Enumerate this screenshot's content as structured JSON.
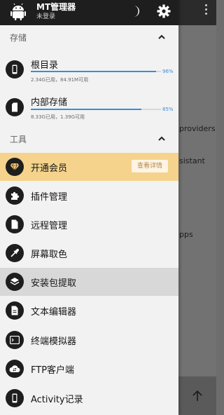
{
  "background": {
    "fragments": [
      "providers",
      "sistant",
      "pps"
    ],
    "up_arrow_icon": "arrow-up-icon"
  },
  "header": {
    "title": "MT管理器",
    "subtitle": "未登录",
    "theme_icon": "moon-icon",
    "settings_icon": "gear-icon"
  },
  "storage": {
    "section_title": "存储",
    "items": [
      {
        "label": "根目录",
        "detail": "2.34G已用，84.91M可用",
        "percent": 96,
        "percent_label": "96%",
        "icon": "phone-icon"
      },
      {
        "label": "内部存储",
        "detail": "8.33G已用，1.39G可用",
        "percent": 85,
        "percent_label": "85%",
        "icon": "sdcard-icon"
      }
    ]
  },
  "tools": {
    "section_title": "工具",
    "items": [
      {
        "label": "开通会员",
        "icon": "diamond-icon",
        "badge": "查看详情"
      },
      {
        "label": "插件管理",
        "icon": "puzzle-icon"
      },
      {
        "label": "远程管理",
        "icon": "document-icon"
      },
      {
        "label": "屏幕取色",
        "icon": "eyedropper-icon"
      },
      {
        "label": "安装包提取",
        "icon": "layers-icon"
      },
      {
        "label": "文本编辑器",
        "icon": "text-file-icon"
      },
      {
        "label": "终端模拟器",
        "icon": "terminal-icon"
      },
      {
        "label": "FTP客户端",
        "icon": "cloud-sync-icon"
      },
      {
        "label": "Activity记录",
        "icon": "phone-icon"
      }
    ]
  },
  "colors": {
    "accent": "#3b8cd8",
    "vip_highlight": "#f5d38c",
    "selected_row": "#d8d8d8",
    "header_bg": "#1e1e1e"
  }
}
